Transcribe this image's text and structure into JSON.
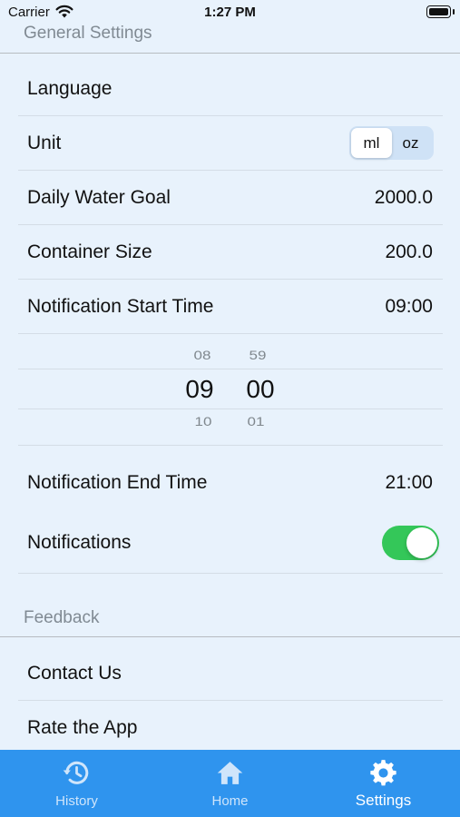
{
  "status_bar": {
    "carrier": "Carrier",
    "time": "1:27 PM"
  },
  "general_section": {
    "header": "General Settings"
  },
  "rows": {
    "language": {
      "label": "Language"
    },
    "unit": {
      "label": "Unit",
      "options": [
        "ml",
        "oz"
      ],
      "selected": "ml"
    },
    "daily_goal": {
      "label": "Daily Water Goal",
      "value": "2000.0"
    },
    "container_size": {
      "label": "Container Size",
      "value": "200.0"
    },
    "start_time": {
      "label": "Notification Start Time",
      "value": "09:00"
    },
    "end_time": {
      "label": "Notification End Time",
      "value": "21:00"
    },
    "notifications": {
      "label": "Notifications",
      "enabled": true
    }
  },
  "picker": {
    "hours": {
      "above": "08",
      "selected": "09",
      "below": "10"
    },
    "minutes": {
      "above": "59",
      "selected": "00",
      "below": "01"
    }
  },
  "feedback_section": {
    "header": "Feedback",
    "contact": "Contact Us",
    "rate": "Rate the App"
  },
  "tab_bar": {
    "tabs": [
      {
        "label": "History",
        "icon": "history-icon"
      },
      {
        "label": "Home",
        "icon": "home-icon"
      },
      {
        "label": "Settings",
        "icon": "gear-icon"
      }
    ],
    "active": "Settings"
  },
  "colors": {
    "background": "#e8f2fc",
    "tab_bar": "#2f94ee",
    "toggle_on": "#34c759",
    "section_header": "#808a93"
  }
}
